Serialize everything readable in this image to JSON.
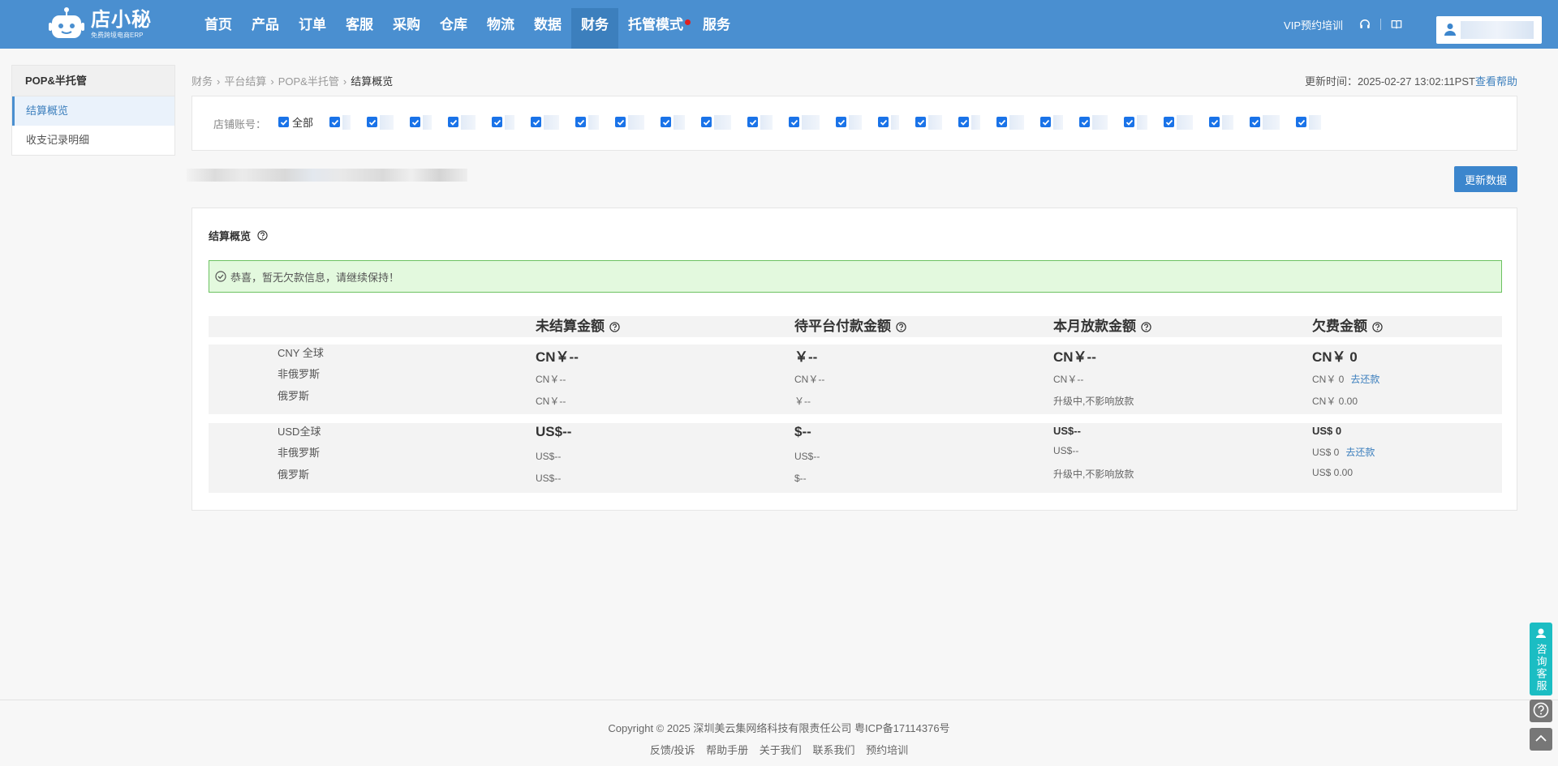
{
  "logo": {
    "name": "店小秘",
    "slogan": "免费跨境电商ERP"
  },
  "nav": [
    {
      "label": "首页"
    },
    {
      "label": "产品"
    },
    {
      "label": "订单"
    },
    {
      "label": "客服"
    },
    {
      "label": "采购"
    },
    {
      "label": "仓库"
    },
    {
      "label": "物流"
    },
    {
      "label": "数据"
    },
    {
      "label": "财务",
      "active": true
    },
    {
      "label": "托管模式",
      "dot": true
    },
    {
      "label": "服务"
    }
  ],
  "topright": {
    "vip": "VIP预约培训"
  },
  "sidebar": {
    "title": "POP&半托管",
    "items": [
      {
        "label": "结算概览",
        "active": true
      },
      {
        "label": "收支记录明细"
      }
    ]
  },
  "breadcrumb": {
    "b1": "财务",
    "b2": "平台结算",
    "b3": "POP&半托管",
    "current": "结算概览"
  },
  "update": {
    "text": "更新时间：2025-02-27 13:02:11PST",
    "help": "查看帮助"
  },
  "store": {
    "label": "店铺账号：",
    "all": "全部",
    "count": 24
  },
  "buttons": {
    "update": "更新数据"
  },
  "panel": {
    "title": "结算概览",
    "alert": "恭喜，暂无欠款信息，请继续保持！",
    "headers": [
      "未结算金额",
      "待平台付款金额",
      "本月放款金额",
      "欠费金额"
    ],
    "cny": {
      "labels": [
        "CNY 全球",
        "非俄罗斯",
        "俄罗斯"
      ],
      "c1": [
        "CN￥--",
        "CN￥--",
        "CN￥--"
      ],
      "c2": [
        "￥--",
        "CN￥--",
        "￥--"
      ],
      "c3": [
        "CN￥--",
        "CN￥--",
        "升级中,不影响放款"
      ],
      "c4": [
        "CN￥ 0",
        "CN￥ 0",
        "CN￥ 0.00"
      ],
      "repay": "去还款"
    },
    "usd": {
      "labels": [
        "USD全球",
        "非俄罗斯",
        "俄罗斯"
      ],
      "c1": [
        "US$--",
        "US$--",
        "US$--"
      ],
      "c2": [
        "$--",
        "US$--",
        "$--"
      ],
      "c3": [
        "US$--",
        "US$--",
        "升级中,不影响放款"
      ],
      "c4": [
        "US$ 0",
        "US$ 0",
        "US$ 0.00"
      ],
      "repay": "去还款"
    }
  },
  "footer": {
    "copyright": "Copyright © 2025 深圳美云集网络科技有限责任公司  粤ICP备17114376号",
    "links": [
      "反馈/投诉",
      "帮助手册",
      "关于我们",
      "联系我们",
      "预约培训"
    ]
  },
  "float": {
    "cs": "咨询客服"
  }
}
